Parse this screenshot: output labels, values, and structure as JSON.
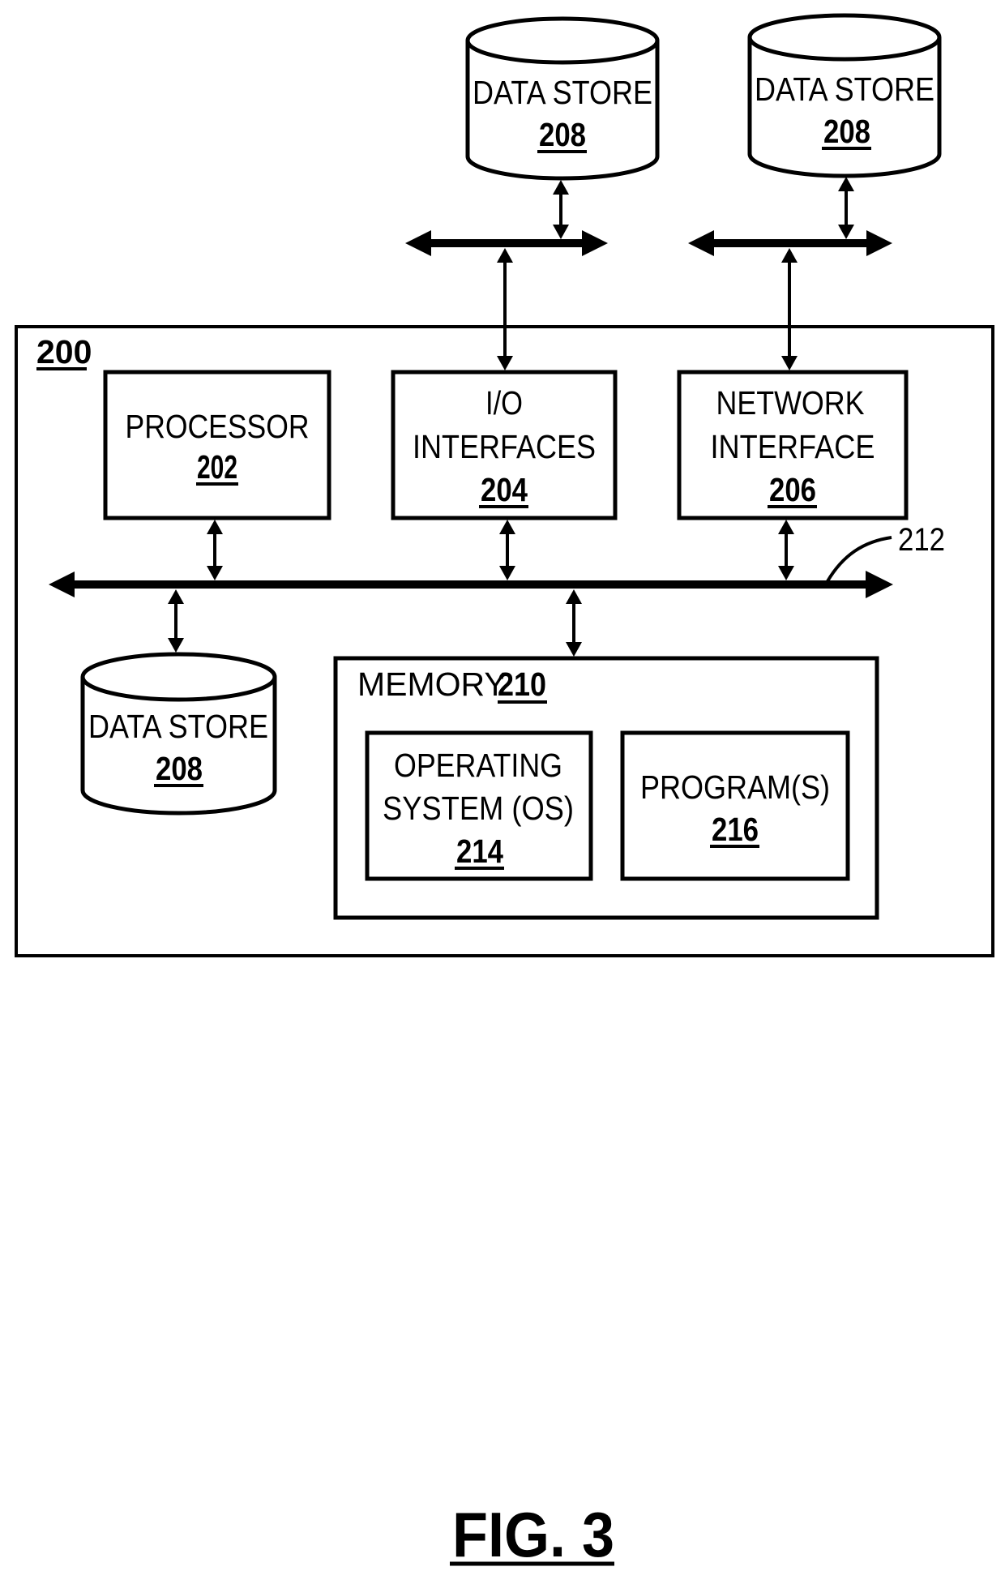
{
  "figure": {
    "label": "FIG. 3",
    "system_ref": "200",
    "bus_ref": "212"
  },
  "components": {
    "processor": {
      "lines": [
        "PROCESSOR"
      ],
      "ref": "202"
    },
    "io_interfaces": {
      "lines": [
        "I/O",
        "INTERFACES"
      ],
      "ref": "204"
    },
    "network_interface": {
      "lines": [
        "NETWORK",
        "INTERFACE"
      ],
      "ref": "206"
    },
    "memory": {
      "label": "MEMORY",
      "ref": "210"
    },
    "operating_system": {
      "lines": [
        "OPERATING",
        "SYSTEM (OS)"
      ],
      "ref": "214"
    },
    "programs": {
      "lines": [
        "PROGRAM(S)"
      ],
      "ref": "216"
    },
    "data_store_internal": {
      "lines": [
        "DATA STORE"
      ],
      "ref": "208"
    },
    "data_store_external_1": {
      "lines": [
        "DATA STORE"
      ],
      "ref": "208"
    },
    "data_store_external_2": {
      "lines": [
        "DATA STORE"
      ],
      "ref": "208"
    }
  },
  "connections": [
    {
      "from": "processor",
      "to": "local-interface-bus",
      "type": "bidirectional"
    },
    {
      "from": "io_interfaces",
      "to": "local-interface-bus",
      "type": "bidirectional"
    },
    {
      "from": "network_interface",
      "to": "local-interface-bus",
      "type": "bidirectional"
    },
    {
      "from": "data_store_internal",
      "to": "local-interface-bus",
      "type": "bidirectional"
    },
    {
      "from": "memory",
      "to": "local-interface-bus",
      "type": "bidirectional"
    },
    {
      "from": "io_interfaces",
      "to": "external-bus-1",
      "type": "bidirectional"
    },
    {
      "from": "data_store_external_1",
      "to": "external-bus-1",
      "type": "bidirectional"
    },
    {
      "from": "network_interface",
      "to": "external-bus-2",
      "type": "bidirectional"
    },
    {
      "from": "data_store_external_2",
      "to": "external-bus-2",
      "type": "bidirectional"
    }
  ]
}
